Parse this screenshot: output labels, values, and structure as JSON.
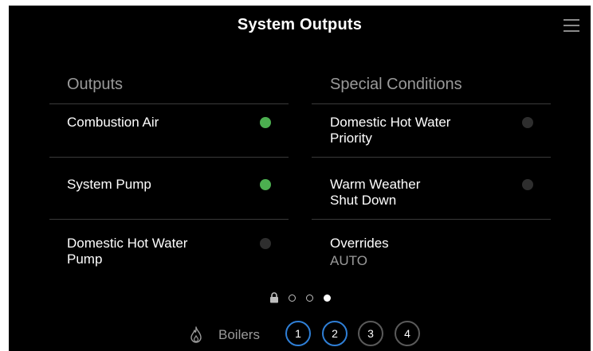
{
  "title": "System Outputs",
  "outputs": {
    "header": "Outputs",
    "items": [
      {
        "label": "Combustion Air",
        "status": "on"
      },
      {
        "label": "System Pump",
        "status": "on"
      },
      {
        "label": "Domestic Hot Water Pump",
        "status": "off"
      }
    ]
  },
  "special_conditions": {
    "header": "Special Conditions",
    "items": [
      {
        "label": "Domestic Hot Water Priority",
        "status": "off"
      },
      {
        "label": "Warm Weather Shut Down",
        "status": "off"
      }
    ],
    "overrides": {
      "label": "Overrides",
      "value": "AUTO"
    }
  },
  "pagination": {
    "total_pages": 4,
    "current_page": 4,
    "first_page_icon": "lock-icon"
  },
  "boilers": {
    "label": "Boilers",
    "icon": "flame-icon",
    "buttons": [
      "1",
      "2",
      "3",
      "4"
    ],
    "highlighted": [
      "1",
      "2"
    ]
  },
  "colors": {
    "background": "#000000",
    "status_on": "#4caf50",
    "status_off": "#2e2e2e",
    "accent": "#2f7fd6",
    "muted_text": "#9a9a9a"
  },
  "icons": {
    "menu": "hamburger-menu-icon"
  }
}
